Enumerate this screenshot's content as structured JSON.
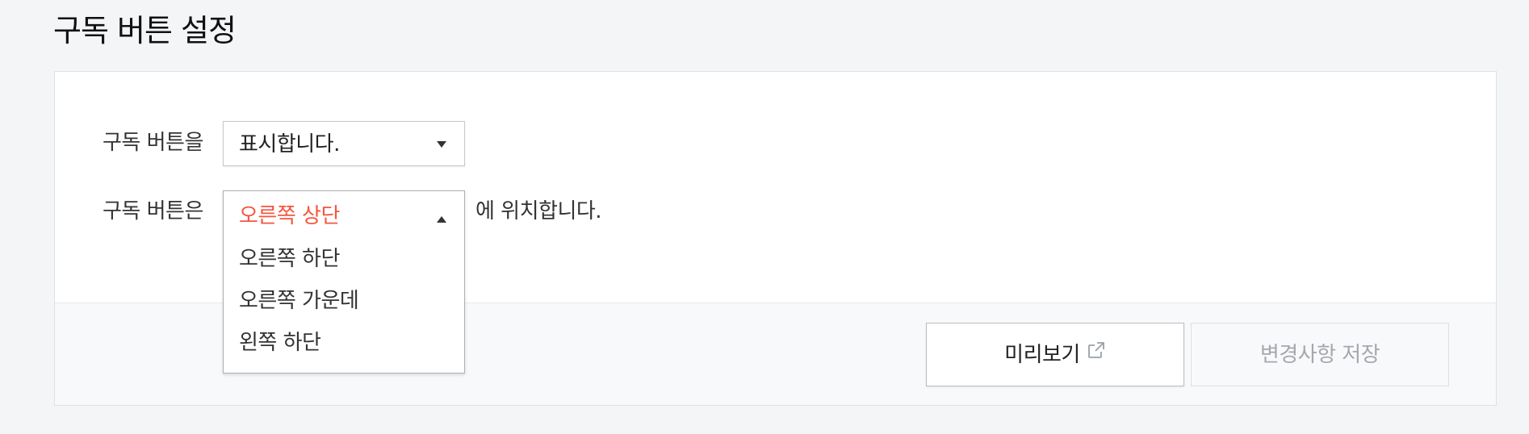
{
  "page": {
    "title": "구독 버튼 설정"
  },
  "form": {
    "display_row": {
      "label": "구독 버튼을",
      "selected": "표시합니다."
    },
    "position_row": {
      "label": "구독 버튼은",
      "selected": "오른쪽 상단",
      "suffix": "에 위치합니다.",
      "options": [
        "오른쪽 하단",
        "오른쪽 가운데",
        "왼쪽 하단"
      ],
      "dropdown_open": true
    }
  },
  "footer": {
    "preview_label": "미리보기",
    "preview_icon": "external-link-icon",
    "save_label": "변경사항 저장",
    "save_enabled": false
  },
  "colors": {
    "background": "#f4f5f7",
    "card": "#ffffff",
    "selected_option": "#f5563d",
    "disabled_text": "#a4a8ae"
  }
}
